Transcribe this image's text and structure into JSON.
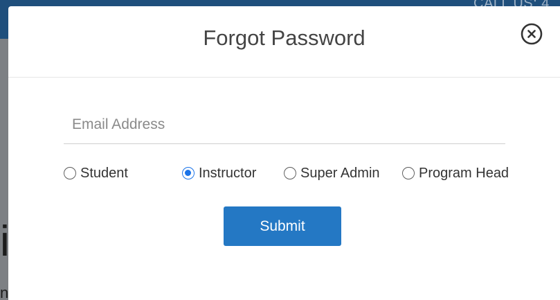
{
  "background": {
    "call_us_text": "CALL US: 4",
    "glyph_large": "i",
    "glyph_small": "n"
  },
  "modal": {
    "title": "Forgot Password",
    "close_icon": "close-circle-icon",
    "email": {
      "placeholder": "Email Address",
      "value": ""
    },
    "roles": [
      {
        "label": "Student",
        "checked": false
      },
      {
        "label": "Instructor",
        "checked": true
      },
      {
        "label": "Super Admin",
        "checked": false
      },
      {
        "label": "Program Head",
        "checked": false
      }
    ],
    "submit_label": "Submit"
  },
  "colors": {
    "accent": "#2478c4",
    "radio_selected": "#1a73e8",
    "title_text": "#444444"
  }
}
